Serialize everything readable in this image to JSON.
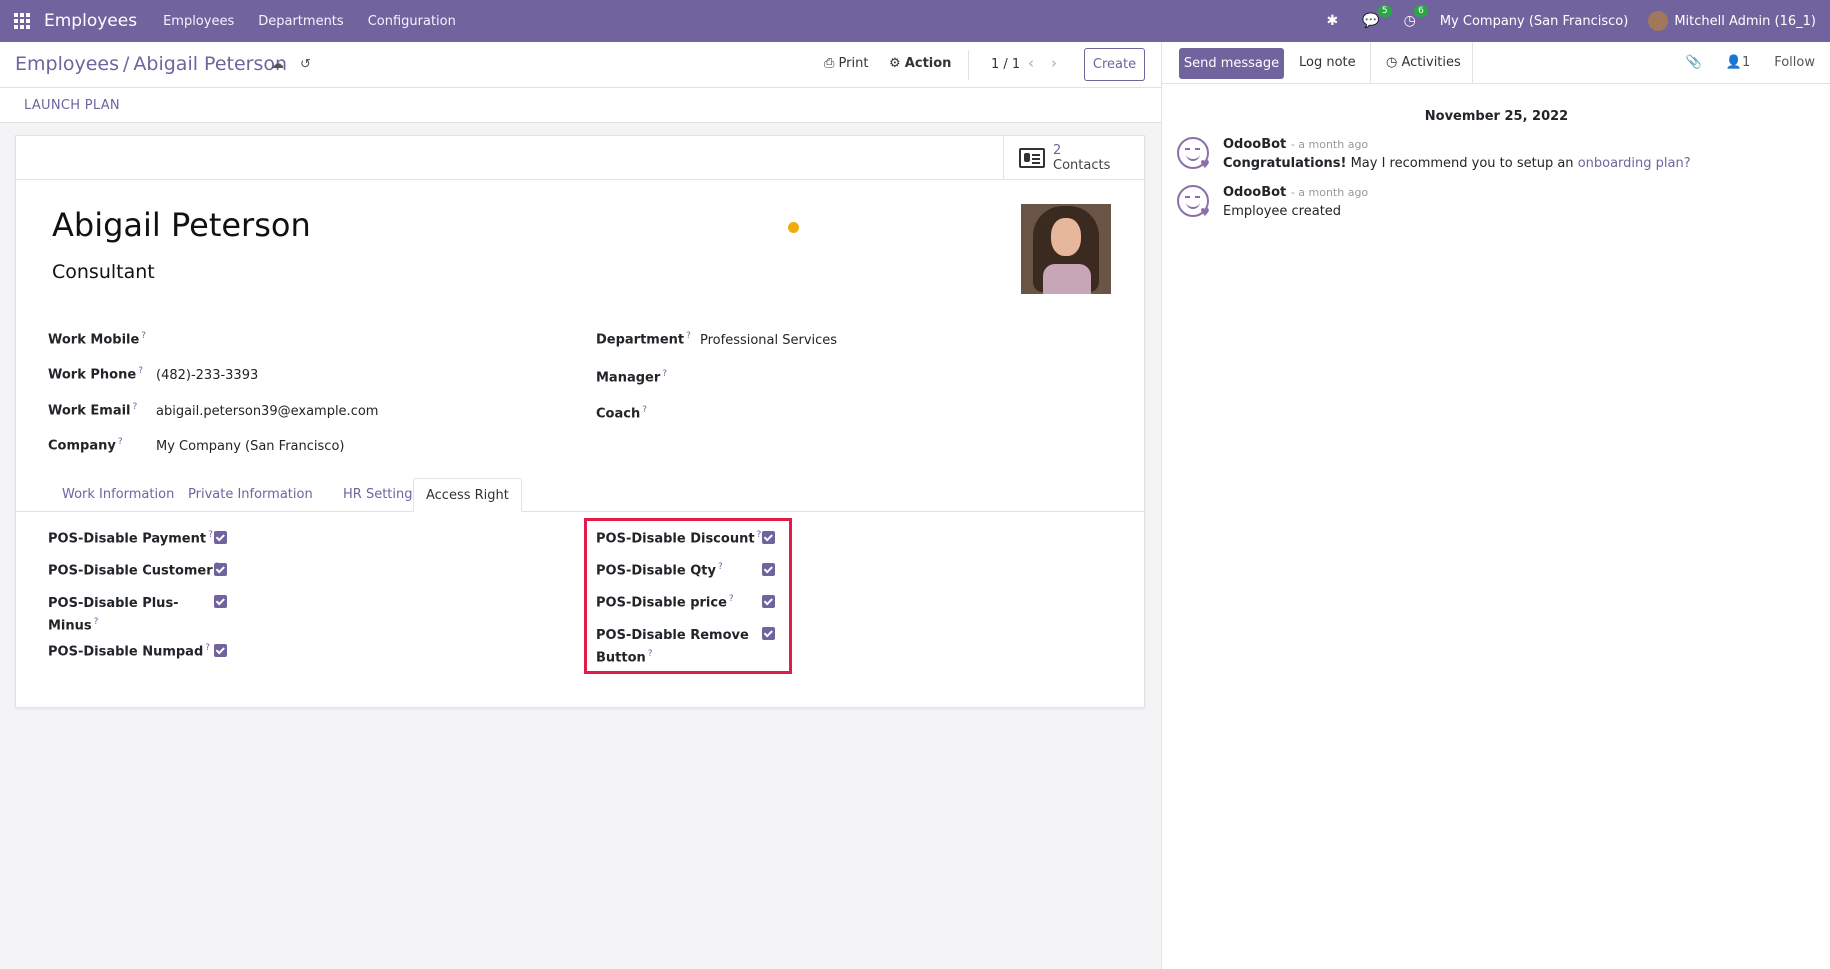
{
  "navbar": {
    "app_title": "Employees",
    "menus": [
      "Employees",
      "Departments",
      "Configuration"
    ],
    "messages_badge": "5",
    "activities_badge": "6",
    "company": "My Company (San Francisco)",
    "user": "Mitchell Admin (16_1)"
  },
  "control": {
    "breadcrumb_parent": "Employees",
    "breadcrumb_sep": "/",
    "breadcrumb_current": "Abigail Peterson",
    "print": "Print",
    "action": "Action",
    "pager": "1 / 1",
    "create": "Create"
  },
  "statusbar": {
    "launch_plan": "LAUNCH PLAN"
  },
  "form": {
    "contacts_count": "2",
    "contacts_label": "Contacts",
    "name": "Abigail Peterson",
    "job_title": "Consultant",
    "fields_left": [
      {
        "label": "Work Mobile",
        "value": ""
      },
      {
        "label": "Work Phone",
        "value": "(482)-233-3393"
      },
      {
        "label": "Work Email",
        "value": "abigail.peterson39@example.com"
      },
      {
        "label": "Company",
        "value": "My Company (San Francisco)"
      }
    ],
    "fields_right": [
      {
        "label": "Department",
        "value": "Professional Services"
      },
      {
        "label": "Manager",
        "value": ""
      },
      {
        "label": "Coach",
        "value": ""
      }
    ],
    "tabs": [
      "Work Information",
      "Private Information",
      "HR Settings",
      "Access Right"
    ],
    "active_tab": "Access Right",
    "access_left": [
      {
        "label": "POS-Disable Payment",
        "checked": true
      },
      {
        "label": "POS-Disable Customer",
        "checked": true
      },
      {
        "label_line1": "POS-Disable Plus-",
        "label_line2": "Minus",
        "checked": true
      },
      {
        "label": "POS-Disable Numpad",
        "checked": true
      }
    ],
    "access_right": [
      {
        "label": "POS-Disable Discount",
        "checked": true
      },
      {
        "label": "POS-Disable Qty",
        "checked": true
      },
      {
        "label": "POS-Disable price",
        "checked": true
      },
      {
        "label_line1": "POS-Disable Remove",
        "label_line2": "Button",
        "checked": true
      }
    ],
    "tooltip_mark": "?"
  },
  "chatter": {
    "send_message": "Send message",
    "log_note": "Log note",
    "activities": "Activities",
    "followers_count": "1",
    "follow": "Follow",
    "date": "November 25, 2022",
    "messages": [
      {
        "author": "OdooBot",
        "time": "- a month ago",
        "body_bold": "Congratulations!",
        "body": " May I recommend you to setup an ",
        "link": "onboarding plan?"
      },
      {
        "author": "OdooBot",
        "time": "- a month ago",
        "body": "Employee created"
      }
    ]
  },
  "colors": {
    "brand": "#71639e",
    "highlight": "#e31b4b",
    "status_dot": "#f0ad0a",
    "badge": "#28a745"
  }
}
